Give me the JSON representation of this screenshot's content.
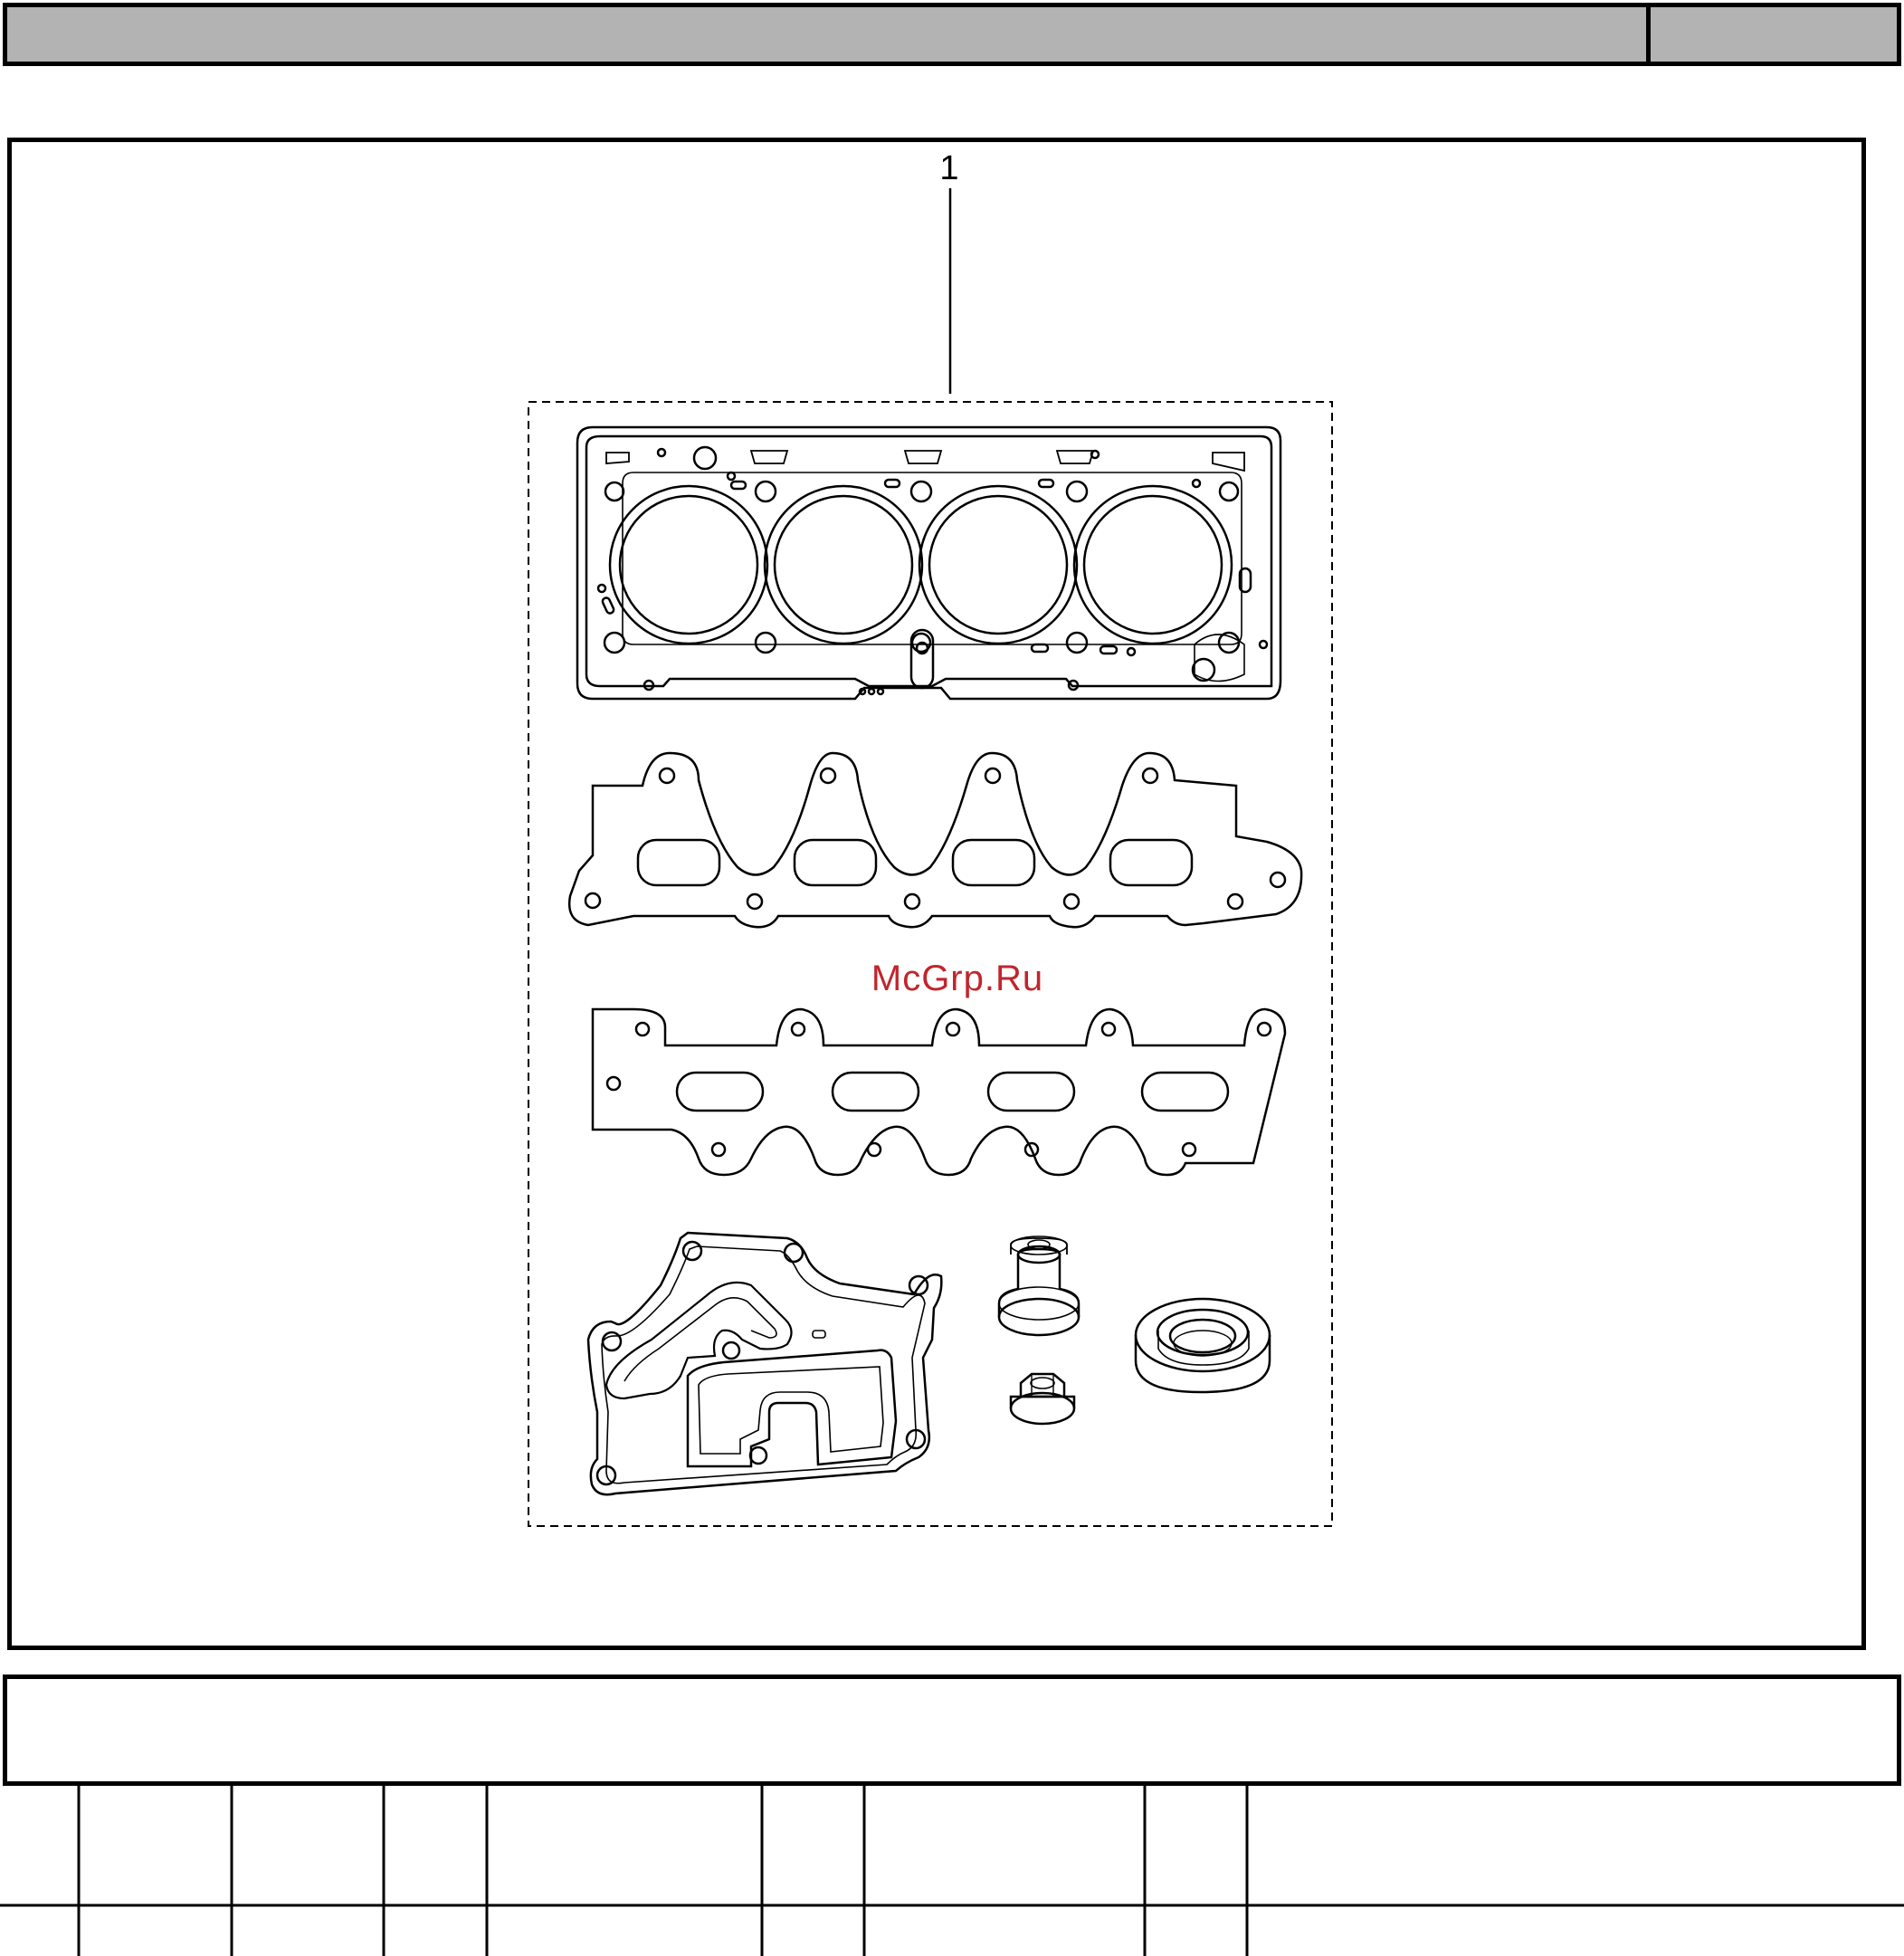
{
  "header": {
    "title": "",
    "code": ""
  },
  "diagram": {
    "callouts": [
      {
        "label": "1",
        "target": "gasket-kit"
      }
    ],
    "kit_contents": [
      "cylinder-head-gasket",
      "intake-manifold-gasket",
      "exhaust-manifold-gasket",
      "water-pump-gasket",
      "valve-stem-seal",
      "nut",
      "oil-seal"
    ]
  },
  "watermark": "McGrp.Ru",
  "caption": {
    "text": ""
  },
  "parts_table": {
    "columns": [
      "",
      "",
      "",
      "",
      "",
      "",
      "",
      "",
      ""
    ],
    "rows": [
      [
        "",
        "",
        "",
        "",
        "",
        "",
        "",
        "",
        ""
      ]
    ]
  }
}
